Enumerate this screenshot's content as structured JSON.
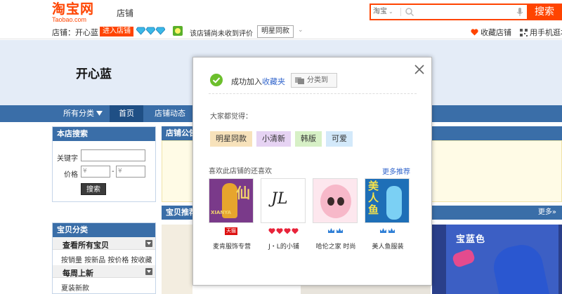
{
  "header": {
    "logo_main": "淘宝网",
    "logo_sub": "Taobao.com",
    "section_label": "店铺",
    "search_scope": "淘宝",
    "search_placeholder": "",
    "search_button": "搜索"
  },
  "shopbar": {
    "shop_label": "店铺：开心蓝",
    "enter_shop": "进入店铺",
    "diamond_count": 3,
    "rating_text": "该店铺尚未收到评价",
    "style_select": "明星同款",
    "favorite_shop": "收藏店铺",
    "mobile_link": "用手机逛本"
  },
  "banner": {
    "shop_name": "开心蓝"
  },
  "nav": {
    "all_categories": "所有分类",
    "home": "首页",
    "dynamics": "店铺动态"
  },
  "sidebar": {
    "search_title": "本店搜索",
    "keyword_label": "关键字",
    "keyword_value": "",
    "price_label": "价格",
    "price_min_placeholder": "¥",
    "price_dash": "-",
    "price_max_placeholder": "¥",
    "search_button": "搜索",
    "categories_title": "宝贝分类",
    "view_all": "查看所有宝贝",
    "sort_links": "按销量 按新品 按价格 按收藏",
    "weekly_new": "每周上新",
    "summer_new": "夏装新款"
  },
  "main": {
    "notice_title": "店铺公告",
    "recommend_title": "宝贝推荐",
    "more": "更多»",
    "product_label": "宝蓝色"
  },
  "modal": {
    "success_prefix": "成功加入",
    "success_link": "收藏夹",
    "classify_button": "分类到",
    "think_label": "大家都觉得：",
    "tags": [
      "明星同款",
      "小清新",
      "韩版",
      "可爱"
    ],
    "also_like": "喜欢此店铺的还喜欢",
    "more_recommend": "更多推荐",
    "shops": [
      {
        "name": "麦肯服饰专营",
        "badge_text": "天猫",
        "thumb_han": "仙",
        "thumb_text": "XIANYA"
      },
      {
        "name": "J・L的小铺",
        "thumb_text": "JL"
      },
      {
        "name": "哈伦之家 时尚",
        "thumb_text": ""
      },
      {
        "name": "美人鱼服装",
        "thumb_text": "美人鱼"
      }
    ]
  },
  "colors": {
    "brand": "#ff4400",
    "nav_blue": "#3a6ea8",
    "banner_bg": "#e4ecf7",
    "link": "#3366cc"
  }
}
